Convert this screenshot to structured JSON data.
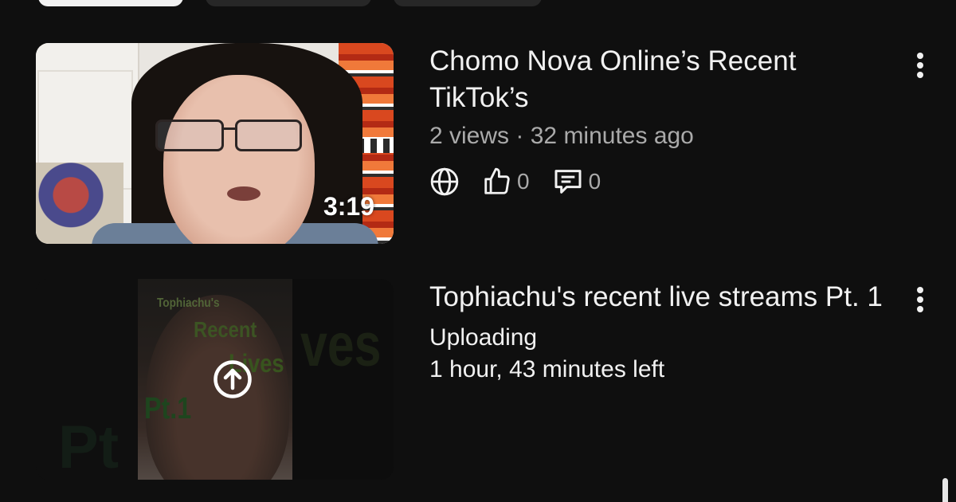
{
  "videos": [
    {
      "title": "Chomo Nova Online’s Recent TikTok’s",
      "duration": "3:19",
      "views": "2 views",
      "separator": "·",
      "age": "32 minutes ago",
      "visibility_icon": "globe-icon",
      "likes": "0",
      "comments": "0"
    },
    {
      "title": "Tophiachu's recent live streams Pt. 1",
      "thumbnail_text": {
        "name": "Tophiachu's",
        "line2": "Recent",
        "line3": "Lives",
        "line4": "Pt.1",
        "bg_left": "Pt",
        "bg_right": "ves"
      },
      "status": "Uploading",
      "time_left": "1 hour, 43 minutes left"
    }
  ],
  "colors": {
    "background": "#0f0f0f",
    "primary_text": "#f1f1f1",
    "secondary_text": "#aaaaaa"
  }
}
